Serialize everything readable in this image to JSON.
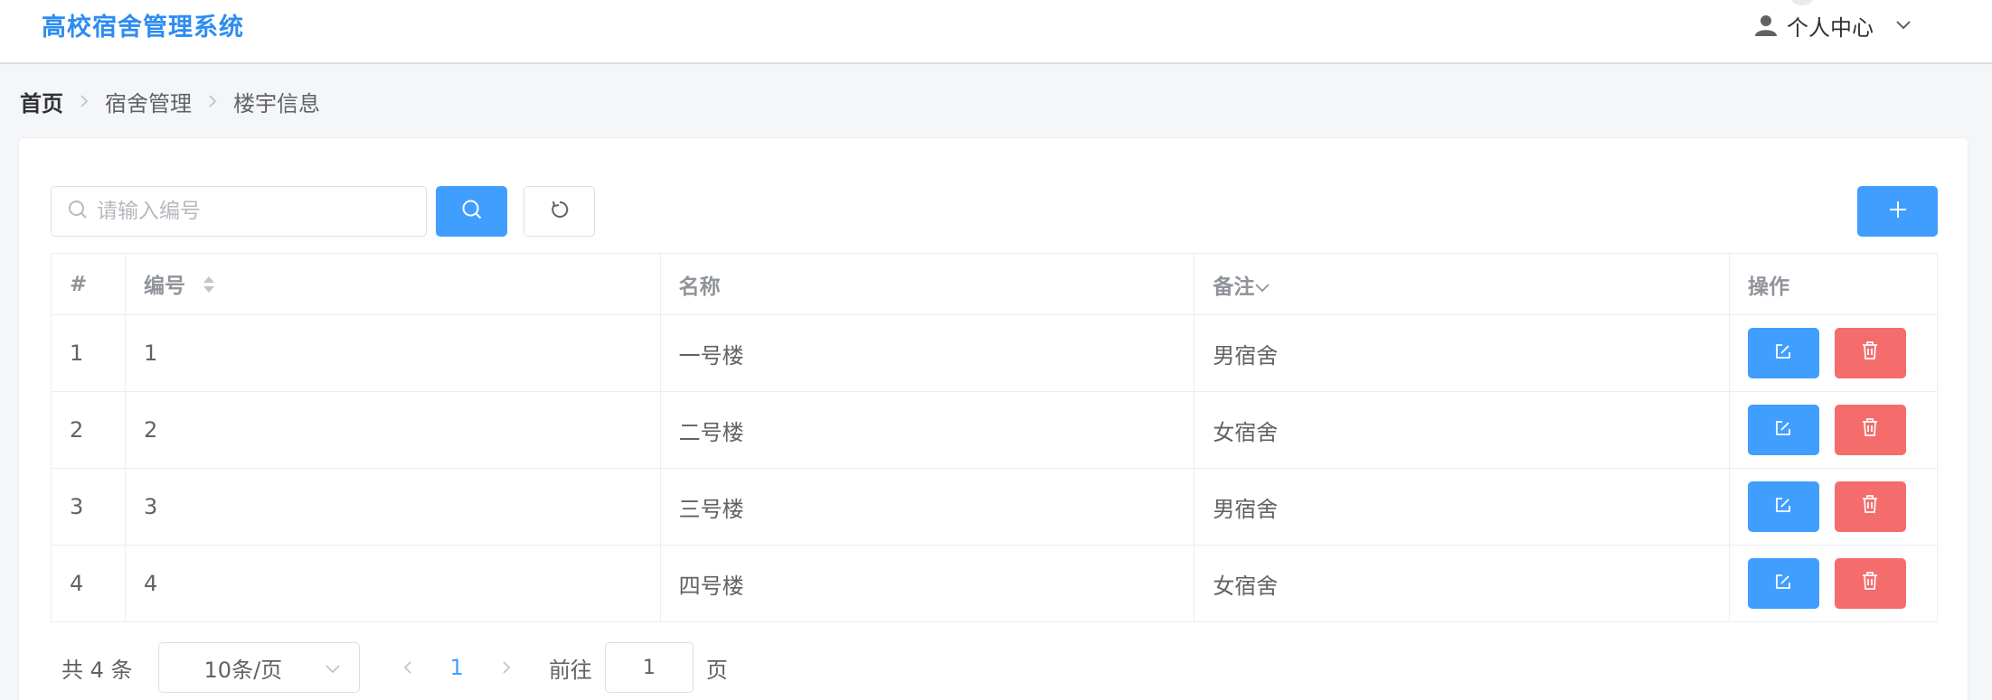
{
  "header": {
    "title": "高校宿舍管理系统",
    "user_center_label": "个人中心"
  },
  "breadcrumb": [
    "首页",
    "宿舍管理",
    "楼宇信息"
  ],
  "toolbar": {
    "search_placeholder": "请输入编号",
    "search_value": ""
  },
  "table": {
    "headers": {
      "index": "#",
      "code": "编号",
      "name": "名称",
      "note": "备注",
      "actions": "操作"
    },
    "rows": [
      {
        "index": "1",
        "code": "1",
        "name": "一号楼",
        "note": "男宿舍"
      },
      {
        "index": "2",
        "code": "2",
        "name": "二号楼",
        "note": "女宿舍"
      },
      {
        "index": "3",
        "code": "3",
        "name": "三号楼",
        "note": "男宿舍"
      },
      {
        "index": "4",
        "code": "4",
        "name": "四号楼",
        "note": "女宿舍"
      }
    ]
  },
  "pagination": {
    "total_text": "共 4 条",
    "page_size": "10条/页",
    "current_page": "1",
    "goto_label": "前往",
    "goto_value": "1",
    "page_unit": "页"
  },
  "colors": {
    "brand": "#2d8cf0",
    "primary": "#409eff",
    "danger": "#f56c6c"
  },
  "icons": {
    "user": "user-icon",
    "dropdown": "chevron-down-icon",
    "search": "search-icon",
    "refresh": "refresh-icon",
    "add": "plus-icon",
    "edit": "edit-icon",
    "delete": "trash-icon",
    "sort": "sort-caret-icon"
  }
}
